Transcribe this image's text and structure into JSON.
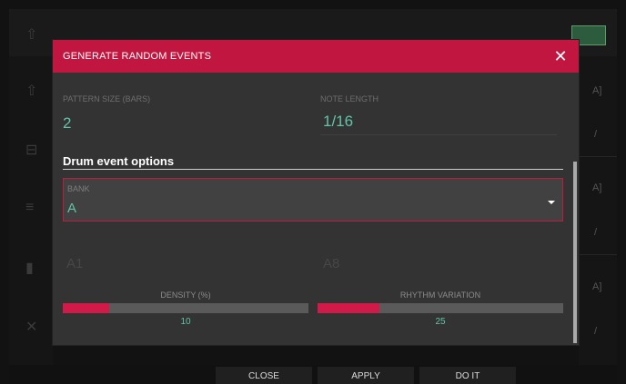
{
  "dialog": {
    "title": "GENERATE RANDOM EVENTS",
    "close_icon": "close-icon"
  },
  "pattern_size": {
    "label": "PATTERN SIZE (BARS)",
    "value": "2"
  },
  "note_length": {
    "label": "NOTE LENGTH",
    "value": "1/16"
  },
  "drum_section": {
    "title": "Drum event options"
  },
  "bank": {
    "label": "BANK",
    "value": "A",
    "caret_icon": "caret-down-icon"
  },
  "pad_range": {
    "start_value": "A1",
    "end_value": "A8"
  },
  "density": {
    "label": "DENSITY (%)",
    "value": "10",
    "fill_fraction": 0.19
  },
  "rhythm_variation": {
    "label": "RHYTHM VARIATION",
    "value": "25",
    "fill_fraction": 0.25
  },
  "buttons": {
    "close": "CLOSE",
    "apply": "APPLY",
    "do_it": "DO IT"
  },
  "colors": {
    "accent": "#c1163f",
    "value_text": "#61c3a7",
    "bar_fill": "#d21a49"
  },
  "background_icons": {
    "left": [
      "home-icon",
      "grid-icon",
      "mixer-icon",
      "bars-icon",
      "xy-icon"
    ],
    "right": [
      "bracket-icon",
      "pencil-icon",
      "bracket-icon",
      "pencil-icon",
      "bracket-icon",
      "pencil-icon"
    ]
  }
}
